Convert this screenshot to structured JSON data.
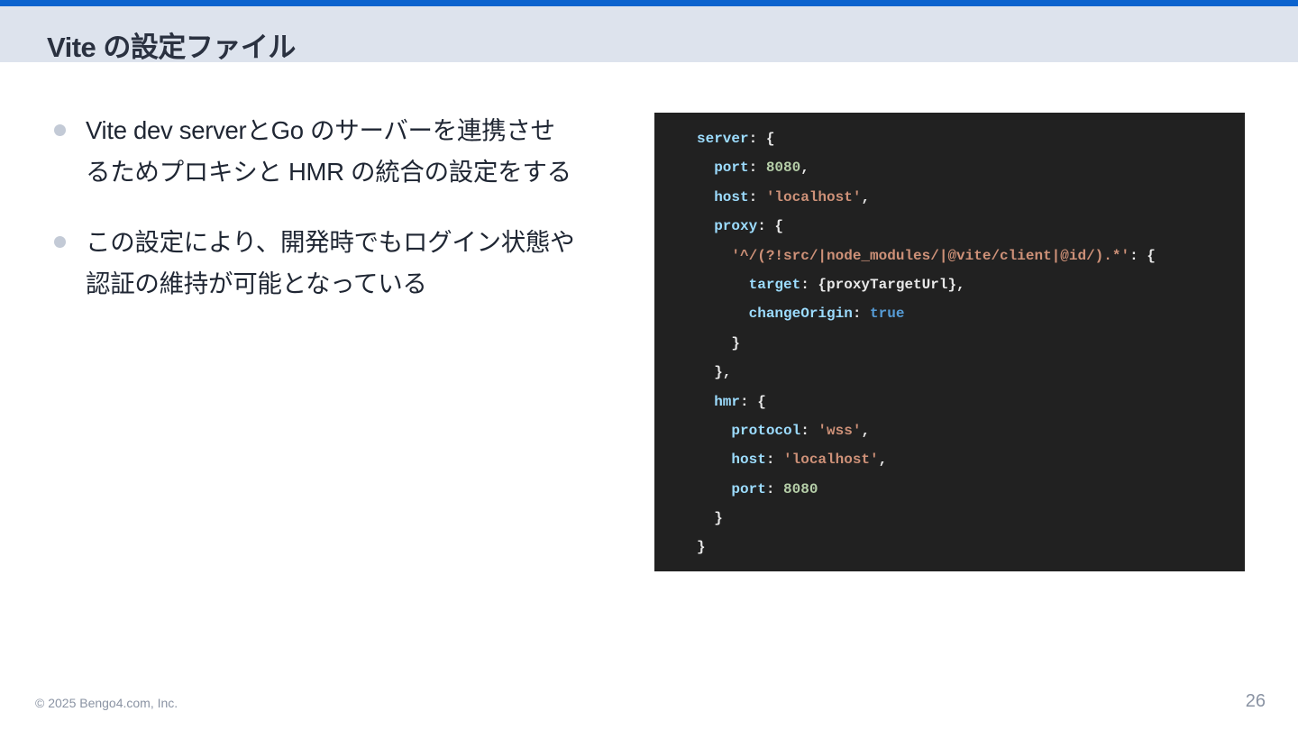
{
  "slide": {
    "title": "Vite の設定ファイル",
    "bullets": [
      {
        "line1": "Vite dev serverとGo のサーバーを連携させ",
        "line2": "るためプロキシと HMR の統合の設定をする"
      },
      {
        "line1": "この設定により、開発時でもログイン状態や",
        "line2": "認証の維持が可能となっている"
      }
    ],
    "code": [
      [
        {
          "t": "server",
          "c": "key"
        },
        {
          "t": ": {",
          "c": "punc"
        }
      ],
      [
        {
          "t": "  port",
          "c": "key"
        },
        {
          "t": ": ",
          "c": "punc"
        },
        {
          "t": "8080",
          "c": "num"
        },
        {
          "t": ",",
          "c": "punc"
        }
      ],
      [
        {
          "t": "  host",
          "c": "key"
        },
        {
          "t": ": ",
          "c": "punc"
        },
        {
          "t": "'localhost'",
          "c": "str"
        },
        {
          "t": ",",
          "c": "punc"
        }
      ],
      [
        {
          "t": "  proxy",
          "c": "key"
        },
        {
          "t": ": {",
          "c": "punc"
        }
      ],
      [
        {
          "t": "    '^/(?!src/|node_modules/|@vite/client|@id/).*'",
          "c": "str"
        },
        {
          "t": ": {",
          "c": "punc"
        }
      ],
      [
        {
          "t": "      target",
          "c": "key"
        },
        {
          "t": ": {proxyTargetUrl},",
          "c": "punc"
        }
      ],
      [
        {
          "t": "      changeOrigin",
          "c": "key"
        },
        {
          "t": ": ",
          "c": "punc"
        },
        {
          "t": "true",
          "c": "kw"
        }
      ],
      [
        {
          "t": "    }",
          "c": "punc"
        }
      ],
      [
        {
          "t": "  },",
          "c": "punc"
        }
      ],
      [
        {
          "t": "  hmr",
          "c": "key"
        },
        {
          "t": ": {",
          "c": "punc"
        }
      ],
      [
        {
          "t": "    protocol",
          "c": "key"
        },
        {
          "t": ": ",
          "c": "punc"
        },
        {
          "t": "'wss'",
          "c": "str"
        },
        {
          "t": ",",
          "c": "punc"
        }
      ],
      [
        {
          "t": "    host",
          "c": "key"
        },
        {
          "t": ": ",
          "c": "punc"
        },
        {
          "t": "'localhost'",
          "c": "str"
        },
        {
          "t": ",",
          "c": "punc"
        }
      ],
      [
        {
          "t": "    port",
          "c": "key"
        },
        {
          "t": ": ",
          "c": "punc"
        },
        {
          "t": "8080",
          "c": "num"
        }
      ],
      [
        {
          "t": "  }",
          "c": "punc"
        }
      ],
      [
        {
          "t": "}",
          "c": "punc"
        }
      ]
    ],
    "footer": {
      "copyright": "© 2025 Bengo4.com, Inc.",
      "page_number": "26"
    }
  },
  "colors": {
    "accent": "#0b63ce",
    "title_band": "#dde3ed",
    "code_bg": "#212121"
  }
}
